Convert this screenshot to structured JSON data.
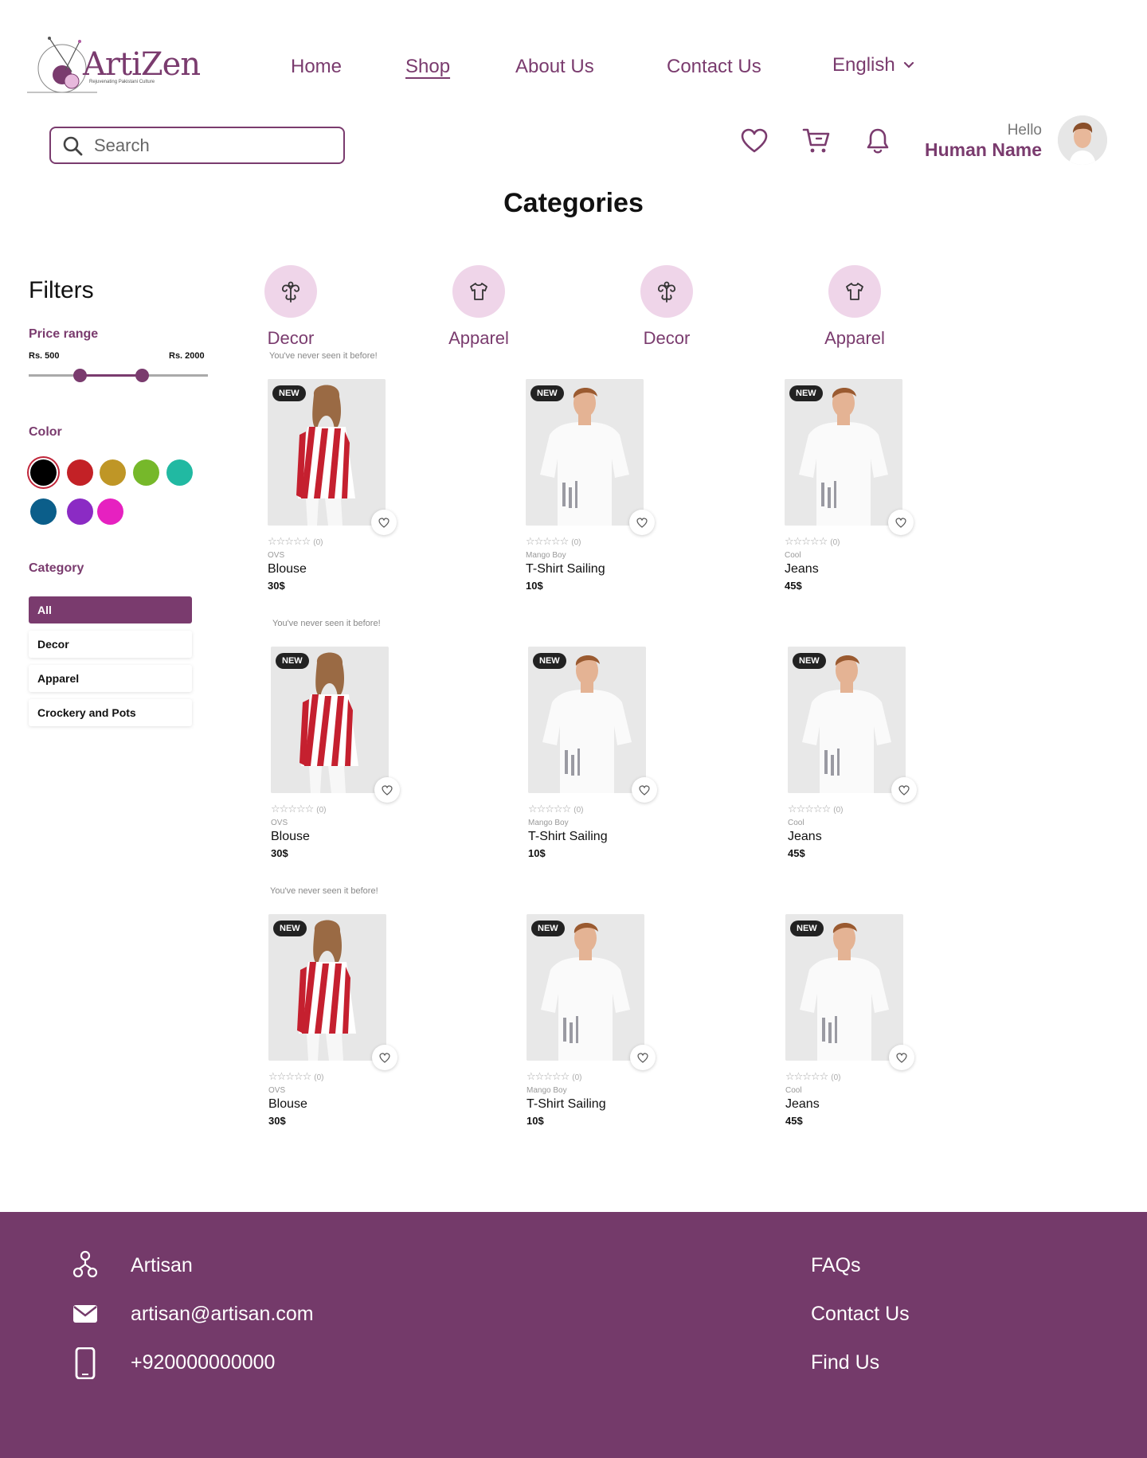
{
  "brand": {
    "name": "ArtiZen",
    "tagline": "Rejuvenating Pakistani Culture",
    "accent": "#7a3b6e",
    "footer_bg": "#743a6a"
  },
  "nav": {
    "items": [
      {
        "label": "Home",
        "active": false
      },
      {
        "label": "Shop",
        "active": true
      },
      {
        "label": "About Us",
        "active": false
      },
      {
        "label": "Contact Us",
        "active": false
      }
    ],
    "language": "English"
  },
  "search": {
    "placeholder": "Search",
    "value": ""
  },
  "user": {
    "greeting": "Hello",
    "name": "Human Name"
  },
  "header_icons": [
    "heart-icon",
    "cart-icon",
    "bell-icon"
  ],
  "page_title": "Categories",
  "filters": {
    "title": "Filters",
    "price_range": {
      "label": "Price range",
      "min_label": "Rs. 500",
      "max_label": "Rs. 2000"
    },
    "color": {
      "label": "Color",
      "swatches": [
        "#000000",
        "#c32126",
        "#bf9626",
        "#76b82a",
        "#21b9a2",
        "#0b5e8a",
        "#8b2bc4",
        "#e621c0"
      ],
      "selected": "#000000"
    },
    "category": {
      "label": "Category",
      "options": [
        {
          "label": "All",
          "active": true
        },
        {
          "label": "Decor",
          "active": false
        },
        {
          "label": "Apparel",
          "active": false
        },
        {
          "label": "Crockery and Pots",
          "active": false
        }
      ]
    }
  },
  "categories": [
    {
      "label": "Decor",
      "icon": "decor-icon"
    },
    {
      "label": "Apparel",
      "icon": "shirt-icon"
    },
    {
      "label": "Decor",
      "icon": "decor-icon"
    },
    {
      "label": "Apparel",
      "icon": "shirt-icon"
    }
  ],
  "product_rows": [
    {
      "note": "You've never seen it before!",
      "products": [
        {
          "badge": "NEW",
          "brand": "OVS",
          "name": "Blouse",
          "price": "30$",
          "reviews": "(0)",
          "image": "blouse"
        },
        {
          "badge": "NEW",
          "brand": "Mango Boy",
          "name": "T-Shirt Sailing",
          "price": "10$",
          "reviews": "(0)",
          "image": "tshirt"
        },
        {
          "badge": "NEW",
          "brand": "Cool",
          "name": "Jeans",
          "price": "45$",
          "reviews": "(0)",
          "image": "tshirt"
        }
      ]
    },
    {
      "note": "You've never seen it before!",
      "products": [
        {
          "badge": "NEW",
          "brand": "OVS",
          "name": "Blouse",
          "price": "30$",
          "reviews": "(0)",
          "image": "blouse"
        },
        {
          "badge": "NEW",
          "brand": "Mango Boy",
          "name": "T-Shirt Sailing",
          "price": "10$",
          "reviews": "(0)",
          "image": "tshirt"
        },
        {
          "badge": "NEW",
          "brand": "Cool",
          "name": "Jeans",
          "price": "45$",
          "reviews": "(0)",
          "image": "tshirt"
        }
      ]
    },
    {
      "note": "You've never seen it before!",
      "products": [
        {
          "badge": "NEW",
          "brand": "OVS",
          "name": "Blouse",
          "price": "30$",
          "reviews": "(0)",
          "image": "blouse"
        },
        {
          "badge": "NEW",
          "brand": "Mango Boy",
          "name": "T-Shirt Sailing",
          "price": "10$",
          "reviews": "(0)",
          "image": "tshirt"
        },
        {
          "badge": "NEW",
          "brand": "Cool",
          "name": "Jeans",
          "price": "45$",
          "reviews": "(0)",
          "image": "tshirt"
        }
      ]
    }
  ],
  "footer": {
    "contact": [
      {
        "icon": "network-icon",
        "text": "Artisan"
      },
      {
        "icon": "mail-icon",
        "text": "artisan@artisan.com"
      },
      {
        "icon": "phone-icon",
        "text": "+920000000000"
      }
    ],
    "links": [
      "FAQs",
      "Contact Us",
      "Find Us"
    ]
  }
}
